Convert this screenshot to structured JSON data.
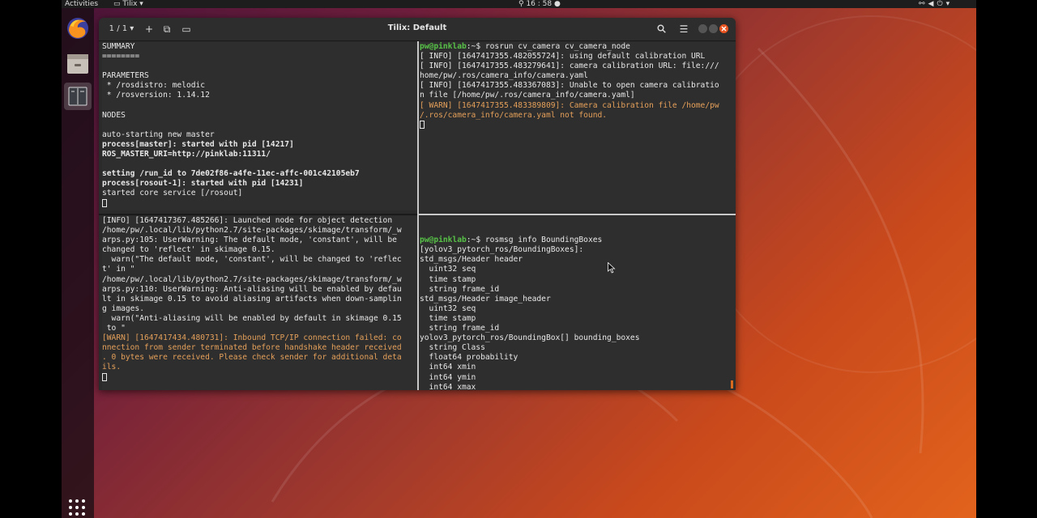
{
  "topbar": {
    "activities": "Activities",
    "app_name": "Tilix",
    "clock": "16 : 58",
    "tray_icons": [
      "network-icon",
      "volume-icon",
      "power-icon"
    ]
  },
  "dock": {
    "items": [
      "firefox-icon",
      "files-icon",
      "tilix-icon"
    ],
    "apps_grid": "show-applications-icon"
  },
  "window": {
    "session_label": "1 / 1",
    "title": "Tilix: Default"
  },
  "panes": {
    "top_left": [
      {
        "t": "SUMMARY"
      },
      {
        "t": "========"
      },
      {
        "t": ""
      },
      {
        "t": "PARAMETERS"
      },
      {
        "t": " * /rosdistro: melodic"
      },
      {
        "t": " * /rosversion: 1.14.12"
      },
      {
        "t": ""
      },
      {
        "t": "NODES"
      },
      {
        "t": ""
      },
      {
        "t": "auto-starting new master"
      },
      {
        "t": "process[master]: started with pid [14217]",
        "s": "b"
      },
      {
        "t": "ROS_MASTER_URI=http://pinklab:11311/",
        "s": "b"
      },
      {
        "t": ""
      },
      {
        "t": "setting /run_id to 7de02f86-a4fe-11ec-affc-001c42105eb7",
        "s": "b"
      },
      {
        "t": "process[rosout-1]: started with pid [14231]",
        "s": "b"
      },
      {
        "t": "started core service [/rosout]"
      }
    ],
    "top_right": [
      {
        "prompt": "pw@pinklab",
        "t": ":~$ rosrun cv_camera cv_camera_node"
      },
      {
        "t": "[ INFO] [1647417355.482055724]: using default calibration URL"
      },
      {
        "t": "[ INFO] [1647417355.483279641]: camera calibration URL: file:///"
      },
      {
        "t": "home/pw/.ros/camera_info/camera.yaml"
      },
      {
        "t": "[ INFO] [1647417355.483367083]: Unable to open camera calibratio"
      },
      {
        "t": "n file [/home/pw/.ros/camera_info/camera.yaml]"
      },
      {
        "t": "[ WARN] [1647417355.483389809]: Camera calibration file /home/pw",
        "s": "w"
      },
      {
        "t": "/.ros/camera_info/camera.yaml not found.",
        "s": "w"
      }
    ],
    "bottom_left": [
      {
        "t": "[INFO] [1647417367.485266]: Launched node for object detection"
      },
      {
        "t": "/home/pw/.local/lib/python2.7/site-packages/skimage/transform/_w"
      },
      {
        "t": "arps.py:105: UserWarning: The default mode, 'constant', will be"
      },
      {
        "t": "changed to 'reflect' in skimage 0.15."
      },
      {
        "t": "  warn(\"The default mode, 'constant', will be changed to 'reflec"
      },
      {
        "t": "t' in \""
      },
      {
        "t": "/home/pw/.local/lib/python2.7/site-packages/skimage/transform/_w"
      },
      {
        "t": "arps.py:110: UserWarning: Anti-aliasing will be enabled by defau"
      },
      {
        "t": "lt in skimage 0.15 to avoid aliasing artifacts when down-samplin"
      },
      {
        "t": "g images."
      },
      {
        "t": "  warn(\"Anti-aliasing will be enabled by default in skimage 0.15"
      },
      {
        "t": " to \""
      },
      {
        "t": "[WARN] [1647417434.480731]: Inbound TCP/IP connection failed: co",
        "s": "w"
      },
      {
        "t": "nnection from sender terminated before handshake header received",
        "s": "w"
      },
      {
        "t": ". 0 bytes were received. Please check sender for additional deta",
        "s": "w"
      },
      {
        "t": "ils.",
        "s": "w"
      }
    ],
    "bottom_right": [
      {
        "t": ""
      },
      {
        "t": ""
      },
      {
        "prompt": "pw@pinklab",
        "t": ":~$ rosmsg info BoundingBoxes"
      },
      {
        "t": "[yolov3_pytorch_ros/BoundingBoxes]:"
      },
      {
        "t": "std_msgs/Header header"
      },
      {
        "t": "  uint32 seq"
      },
      {
        "t": "  time stamp"
      },
      {
        "t": "  string frame_id"
      },
      {
        "t": "std_msgs/Header image_header"
      },
      {
        "t": "  uint32 seq"
      },
      {
        "t": "  time stamp"
      },
      {
        "t": "  string frame_id"
      },
      {
        "t": "yolov3_pytorch_ros/BoundingBox[] bounding_boxes"
      },
      {
        "t": "  string Class"
      },
      {
        "t": "  float64 probability"
      },
      {
        "t": "  int64 xmin"
      },
      {
        "t": "  int64 ymin"
      },
      {
        "t": "  int64 xmax"
      }
    ]
  },
  "colors": {
    "prompt": "#57c247",
    "warn": "#e5a05a",
    "terminal_bg": "#2e2e2e",
    "accent": "#e95420"
  }
}
